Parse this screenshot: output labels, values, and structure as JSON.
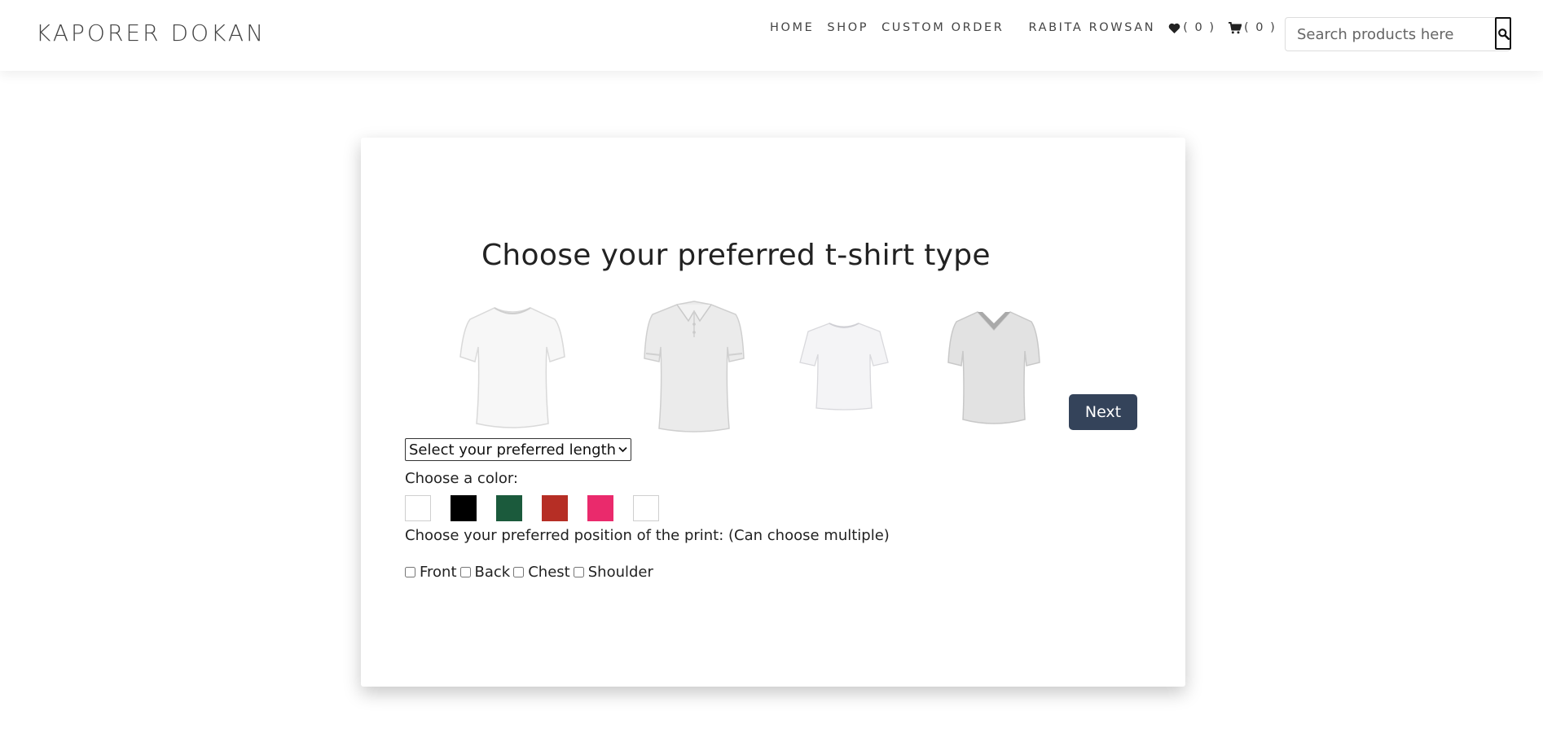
{
  "header": {
    "brand": "KAPORER DOKAN",
    "nav": {
      "home": "HOME",
      "shop": "SHOP",
      "custom_order": "CUSTOM ORDER",
      "user": "RABITA ROWSAN"
    },
    "wishlist_count": "( 0 )",
    "cart_count": "( 0 )",
    "search_placeholder": "Search products here"
  },
  "main": {
    "title": "Choose your preferred t-shirt type",
    "shirts": [
      {
        "name": "crew-neck-tshirt",
        "icon": "tshirt-crew-image"
      },
      {
        "name": "polo-shirt",
        "icon": "polo-shirt-image"
      },
      {
        "name": "oversized-tshirt",
        "icon": "tshirt-oversized-image"
      },
      {
        "name": "v-neck-tshirt",
        "icon": "tshirt-vneck-image"
      }
    ],
    "next_label": "Next",
    "length_select": "Select your preferred length",
    "color_label": "Choose a color:",
    "colors": [
      "#ffffff",
      "#000000",
      "#1b5a3c",
      "#b62e25",
      "#ea2a6c",
      "#ffffff"
    ],
    "print_label": "Choose your preferred position of the print: (Can choose multiple)",
    "print_options": [
      "Front",
      "Back",
      "Chest",
      "Shoulder"
    ]
  }
}
